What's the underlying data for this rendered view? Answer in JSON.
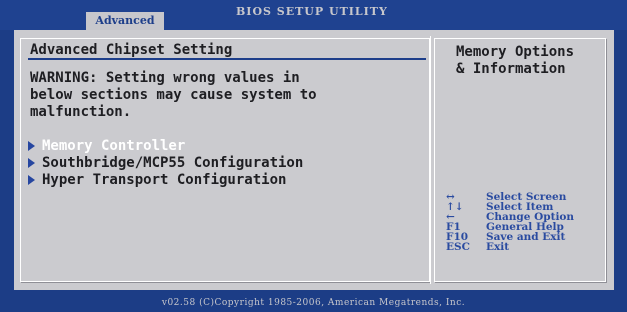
{
  "header": {
    "active_tab": "Advanced",
    "utility_title": "BIOS SETUP UTILITY"
  },
  "main": {
    "title": "Advanced Chipset Setting",
    "warning": "WARNING: Setting wrong values in\nbelow sections may cause system to\nmalfunction.",
    "menu_items": [
      {
        "label": "Memory Controller",
        "selected": true
      },
      {
        "label": "Southbridge/MCP55 Configuration",
        "selected": false
      },
      {
        "label": "Hyper Transport Configuration",
        "selected": false
      }
    ]
  },
  "help": {
    "text": "Memory Options\n& Information",
    "keys": [
      {
        "key": "↔",
        "action": "Select Screen"
      },
      {
        "key": "↑↓",
        "action": "Select Item"
      },
      {
        "key": "←",
        "action": "Change Option"
      },
      {
        "key": "F1",
        "action": "General Help"
      },
      {
        "key": "F10",
        "action": "Save and Exit"
      },
      {
        "key": "ESC",
        "action": "Exit"
      }
    ]
  },
  "footer": {
    "text": "v02.58 (C)Copyright 1985-2006, American Megatrends, Inc."
  },
  "colors": {
    "background": "#1c3d86",
    "panel": "#cbcbcf",
    "selected_text": "#ffffff",
    "text": "#1e1e22",
    "accent": "#2646a0"
  }
}
